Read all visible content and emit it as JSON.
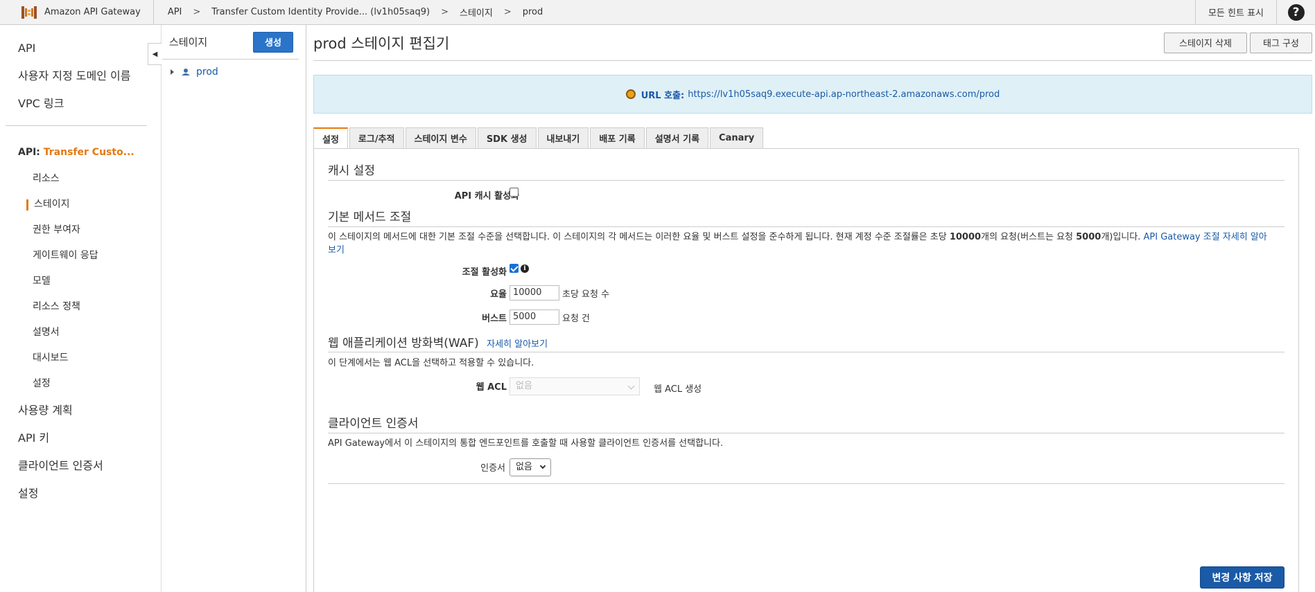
{
  "topbar": {
    "app_name": "Amazon API Gateway",
    "crumbs": [
      "API",
      "Transfer Custom Identity Provide... (lv1h05saq9)",
      "스테이지",
      "prod"
    ],
    "separator": ">",
    "hint_label": "모든 힌트 표시",
    "help_label": "?"
  },
  "sidebar": {
    "top_items": [
      "API",
      "사용자 지정 도메인 이름",
      "VPC 링크"
    ],
    "api_prefix": "API:",
    "api_name": "Transfer Custo...",
    "sub_items": [
      "리소스",
      "스테이지",
      "권한 부여자",
      "게이트웨이 응답",
      "모델",
      "리소스 정책",
      "설명서",
      "대시보드",
      "설정"
    ],
    "active_sub_item": "스테이지",
    "bottom_items": [
      "사용량 계획",
      "API 키",
      "클라이언트 인증서",
      "설정"
    ]
  },
  "stages": {
    "title": "스테이지",
    "create_label": "생성",
    "tree": [
      {
        "name": "prod"
      }
    ]
  },
  "main": {
    "title": "prod 스테이지 편집기",
    "delete_label": "스테이지 삭제",
    "tags_label": "태그 구성",
    "url_label": "URL 호출:",
    "url": "https://lv1h05saq9.execute-api.ap-northeast-2.amazonaws.com/prod",
    "tabs": [
      "설정",
      "로그/추적",
      "스테이지 변수",
      "SDK 생성",
      "내보내기",
      "배포 기록",
      "설명서 기록",
      "Canary"
    ],
    "active_tab": "설정"
  },
  "settings": {
    "cache": {
      "title": "캐시 설정",
      "enable_label": "API 캐시 활성화",
      "enabled": false
    },
    "throttle": {
      "title": "기본 메서드 조절",
      "desc_1": "이 스테이지의 메서드에 대한 기본 조절 수준을 선택합니다. 이 스테이지의 각 메서드는 이러한 요율 및 버스트 설정을 준수하게 됩니다. 현재 계정 수준 조절률은 초당 ",
      "desc_rate": "10000",
      "desc_2": "개의 요청(버스트는 요청 ",
      "desc_burst": "5000",
      "desc_3": "개)입니다. ",
      "desc_link": "API Gateway 조절 자세히 알아보기",
      "enable_label": "조절 활성화",
      "enabled": true,
      "info_icon": "i",
      "rate_label": "요율",
      "rate_value": "10000",
      "rate_unit": "초당 요청 수",
      "burst_label": "버스트",
      "burst_value": "5000",
      "burst_unit": "요청 건"
    },
    "waf": {
      "title": "웹 애플리케이션 방화벽(WAF)",
      "learn_more": "자세히 알아보기",
      "desc": "이 단계에서는 웹 ACL을 선택하고 적용할 수 있습니다.",
      "acl_label": "웹 ACL",
      "acl_value": "없음",
      "create_acl": "웹 ACL 생성"
    },
    "client_cert": {
      "title": "클라이언트 인증서",
      "desc": "API Gateway에서 이 스테이지의 통합 엔드포인트를 호출할 때 사용할 클라이언트 인증서를 선택합니다.",
      "cert_label": "인증서",
      "cert_value": "없음"
    },
    "save_label": "변경 사항 저장"
  },
  "colors": {
    "accent_orange": "#e47911",
    "primary_blue": "#1a5aa6",
    "info_bg": "#dff0f7"
  }
}
